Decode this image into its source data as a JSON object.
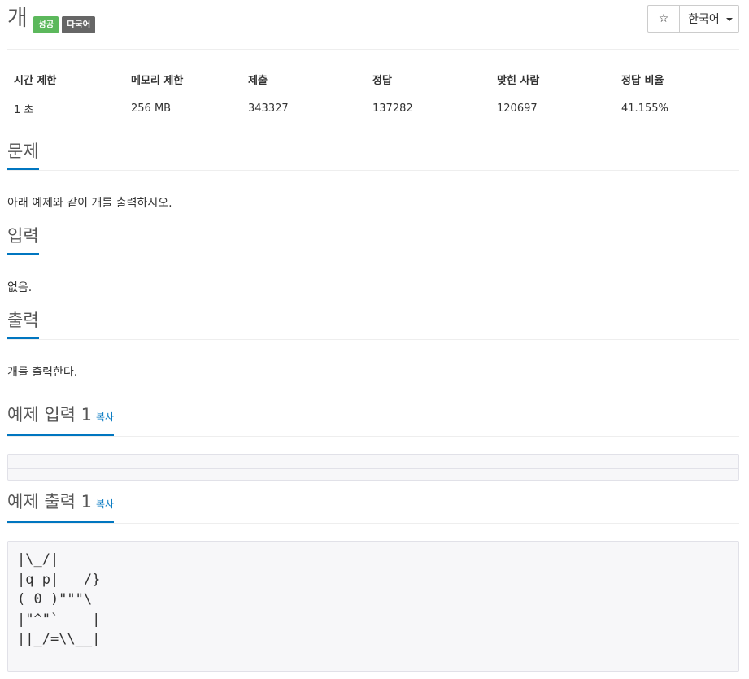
{
  "problem": {
    "title": "개",
    "badges": [
      {
        "text": "성공",
        "color": "#5cb85c"
      },
      {
        "text": "다국어",
        "color": "#666666"
      }
    ]
  },
  "toolbar": {
    "star_glyph": "☆",
    "language": "한국어"
  },
  "info": {
    "headers": [
      "시간 제한",
      "메모리 제한",
      "제출",
      "정답",
      "맞힌 사람",
      "정답 비율"
    ],
    "values": [
      "1 초",
      "256 MB",
      "343327",
      "137282",
      "120697",
      "41.155%"
    ]
  },
  "sections": {
    "problem": {
      "heading": "문제",
      "text": "아래 예제와 같이 개를 출력하시오."
    },
    "input": {
      "heading": "입력",
      "text": "없음."
    },
    "output": {
      "heading": "출력",
      "text": "개를 출력한다."
    },
    "sample_input": {
      "heading": "예제 입력 1",
      "copy": "복사",
      "content": ""
    },
    "sample_output": {
      "heading": "예제 출력 1",
      "copy": "복사",
      "content": "|\\_/|\n|q p|   /}\n( 0 )\"\"\"\\\n|\"^\"`    |\n||_/=\\\\__|"
    }
  },
  "colors": {
    "accent": "#0076c0",
    "success": "#5cb85c",
    "neutral": "#666666"
  }
}
